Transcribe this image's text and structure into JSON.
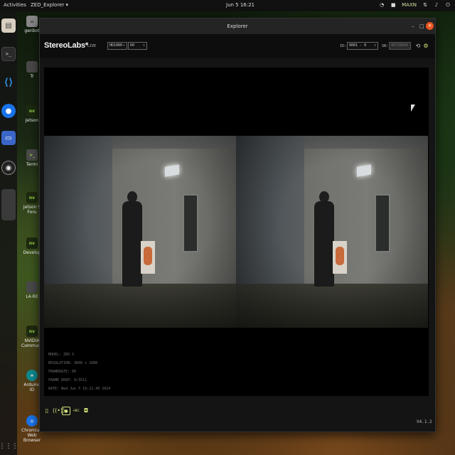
{
  "topbar": {
    "activities": "Activities",
    "app_menu": "ZED_Explorer ▾",
    "clock": "Jun 5  16:21",
    "tray_label": "MAXN"
  },
  "desktop_icons": [
    {
      "name": "home-folder",
      "label": "genbot",
      "glyph": "⌂"
    },
    {
      "name": "trash",
      "label": "Tr",
      "glyph": ""
    },
    {
      "name": "jetson-zoo",
      "label": "Jetson",
      "glyph": "nv"
    },
    {
      "name": "terminal",
      "label": "Termi",
      "glyph": ">_"
    },
    {
      "name": "jetson-forums",
      "label": "Jetson S Foru",
      "glyph": "nv"
    },
    {
      "name": "jetson-developer",
      "label": "Develop",
      "glyph": "nv"
    },
    {
      "name": "l4t-readme",
      "label": "L4-RE",
      "glyph": ""
    },
    {
      "name": "nvidia-community",
      "label": "NVIDIA Communit",
      "glyph": "nv"
    },
    {
      "name": "arduino-ide",
      "label": "Arduino ID",
      "glyph": "∞"
    },
    {
      "name": "chromium",
      "label": "Chromium Web Browser",
      "glyph": "◎"
    }
  ],
  "window": {
    "title": "Explorer",
    "minimize": "–",
    "maximize": "□",
    "close": "×"
  },
  "toolbar": {
    "brand": "StereoLabs*",
    "live": "LIVE",
    "resolution": "HD1080",
    "fps": "60",
    "id_label": "ID:",
    "id_value": "0001 - 0",
    "sn_label": "SN:",
    "sn_value": "40728956"
  },
  "overlay": {
    "model": "MODEL: ZED X",
    "resolution": "RESOLUTION: 3840 x 1080",
    "framerate": "FRAMERATE: 60",
    "frame_drop": "FRAME DROP: 0/3511",
    "date": "DATE: Wed Jun 5 16:21:40 2024"
  },
  "bottombar": {
    "svo_label": "•REC",
    "version": "V4.1.2"
  },
  "colors": {
    "accent": "#cfe07a",
    "close_button": "#e9541f",
    "window_bg": "#141414"
  }
}
